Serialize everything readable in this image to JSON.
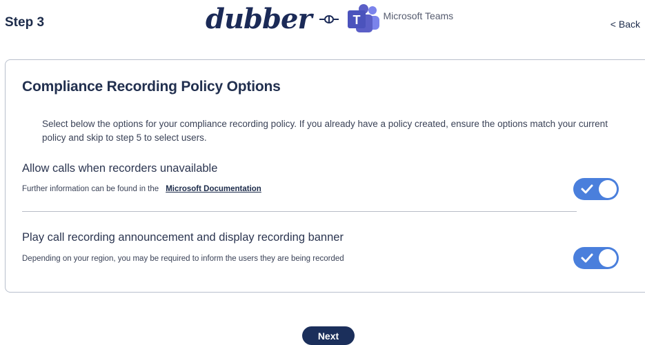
{
  "header": {
    "step_label": "Step 3",
    "brand_name": "dubber",
    "partner_name": "Microsoft Teams",
    "back_label": "< Back"
  },
  "card": {
    "title": "Compliance Recording Policy Options",
    "intro": "Select below the options for your compliance recording policy. If you already have a policy created, ensure the options match your current policy and skip to step 5 to select users."
  },
  "options": [
    {
      "title": "Allow calls when recorders unavailable",
      "description": "Further information can be found in the",
      "link_label": "Microsoft Documentation",
      "enabled": true
    },
    {
      "title": "Play call recording announcement and display recording banner",
      "description": "Depending on your region, you may be required to inform the users they are being recorded",
      "enabled": true
    }
  ],
  "footer": {
    "next_label": "Next"
  },
  "colors": {
    "toggle_on": "#4a7fdc",
    "primary": "#1b2f5b",
    "teams": "#5b5fc7"
  },
  "icons": {
    "connector": "connector-icon",
    "teams": "teams-icon",
    "check": "check-icon"
  }
}
